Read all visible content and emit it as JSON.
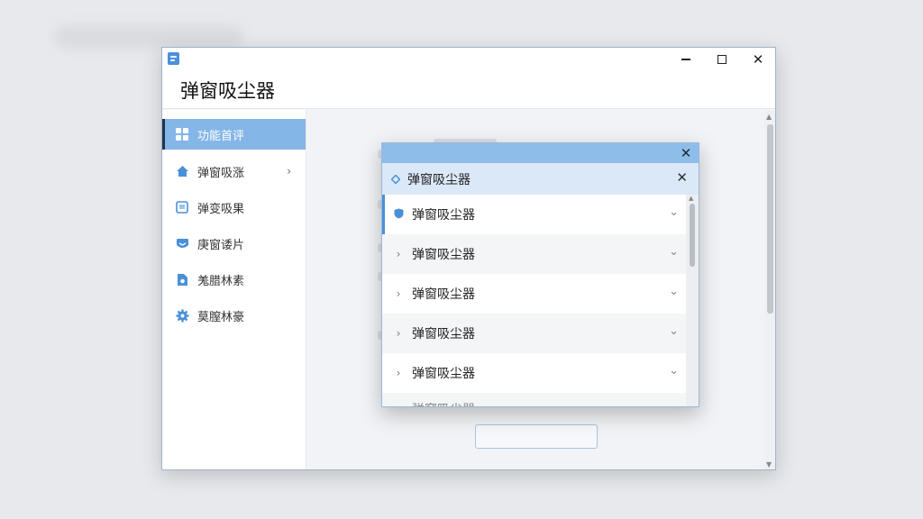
{
  "window": {
    "title": "弹窗吸尘器",
    "controls": {
      "minimize": "–",
      "maximize": "□",
      "close": "✕"
    }
  },
  "sidebar": {
    "items": [
      {
        "label": "功能首评",
        "icon": "grid-icon",
        "active": true
      },
      {
        "label": "弹窗吸涨",
        "icon": "home-icon",
        "chevron": "›"
      },
      {
        "label": "弹变吸果",
        "icon": "window-icon"
      },
      {
        "label": "庚窗诿片",
        "icon": "inbox-icon"
      },
      {
        "label": "羗腊林素",
        "icon": "document-icon"
      },
      {
        "label": "莫膣林豪",
        "icon": "gear-icon"
      }
    ]
  },
  "dialog": {
    "close_label": "✕",
    "header": {
      "label": "弹窗吸尘器",
      "icon": "diamond-icon",
      "clear_label": "✕"
    },
    "rows": [
      {
        "label": "弹窗吸尘器",
        "icon": "shield-icon",
        "caret": "⌄"
      },
      {
        "label": "弹窗吸尘器",
        "icon": "chevron-right-icon",
        "lead": "›",
        "caret": "⌄"
      },
      {
        "label": "弹窗吸尘器",
        "icon": "chevron-right-icon",
        "lead": "›",
        "caret": "⌄"
      },
      {
        "label": "弹窗吸尘器",
        "icon": "chevron-right-icon",
        "lead": "›",
        "caret": "⌄"
      },
      {
        "label": "弹窗吸尘器",
        "icon": "chevron-right-icon",
        "lead": "›",
        "caret": "⌄"
      },
      {
        "label": "弹窗吸尘器",
        "partial": true
      }
    ]
  },
  "colors": {
    "accent": "#84b6e8",
    "dialog_title": "#8ebde9",
    "dialog_header": "#dbe8f7",
    "brand": "#4a90d9"
  }
}
